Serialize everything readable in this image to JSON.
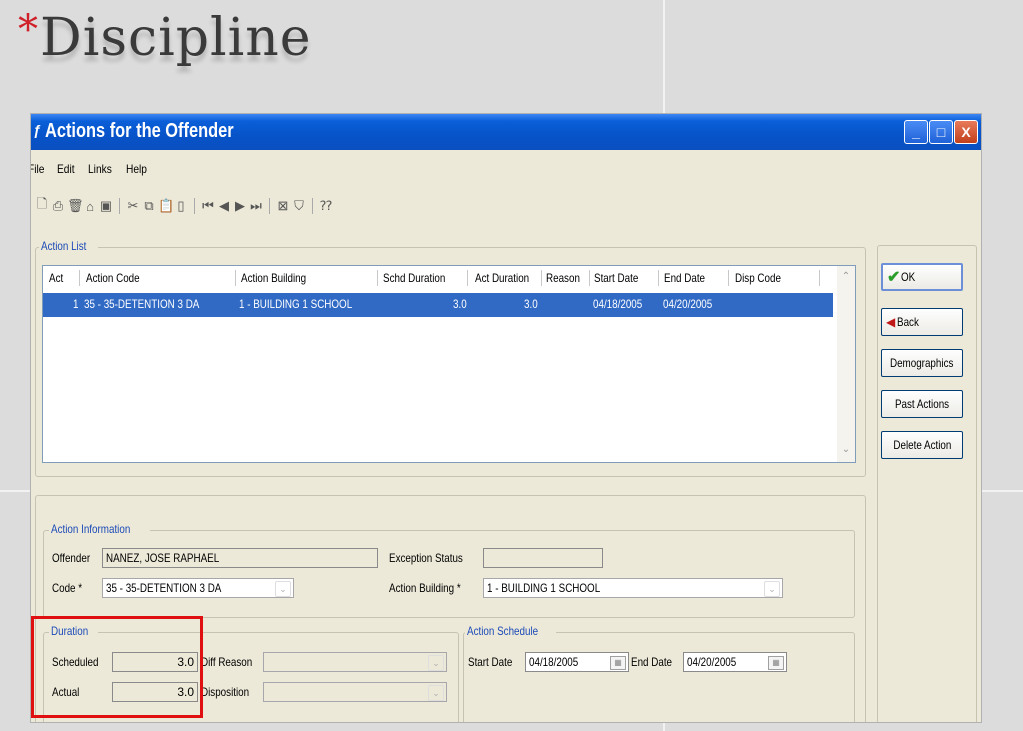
{
  "slide": {
    "star": "*",
    "title": "Discipline"
  },
  "window": {
    "title": "Actions for the Offender",
    "min_glyph": "_",
    "max_glyph": "□",
    "close_glyph": "X"
  },
  "menu": {
    "file": "File",
    "edit": "Edit",
    "links": "Links",
    "help": "Help"
  },
  "action_list": {
    "group_label": "Action List",
    "columns": [
      "Act",
      "Action Code",
      "Action Building",
      "Schd Duration",
      "Act Duration",
      "Reason",
      "Start Date",
      "End Date",
      "Disp Code"
    ],
    "rows": [
      {
        "act": "1",
        "action_code": "35 - 35-DETENTION 3 DA",
        "action_building": "1 - BUILDING 1 SCHOOL",
        "schd_duration": "3.0",
        "act_duration": "3.0",
        "reason": "",
        "start_date": "04/18/2005",
        "end_date": "04/20/2005",
        "disp_code": ""
      }
    ]
  },
  "buttons": {
    "ok": "OK",
    "back": "Back",
    "demographics": "Demographics",
    "past_actions": "Past Actions",
    "delete_action": "Delete Action"
  },
  "action_info": {
    "group_label": "Action Information",
    "offender_label": "Offender",
    "offender_value": "NANEZ, JOSE RAPHAEL",
    "exception_status_label": "Exception Status",
    "exception_status_value": "",
    "code_label": "Code *",
    "code_value": "35 - 35-DETENTION 3 DA",
    "action_building_label": "Action Building *",
    "action_building_value": "1 - BUILDING 1 SCHOOL"
  },
  "duration": {
    "group_label": "Duration",
    "scheduled_label": "Scheduled",
    "scheduled_value": "3.0",
    "actual_label": "Actual",
    "actual_value": "3.0",
    "diff_reason_label": "Diff Reason",
    "diff_reason_value": "",
    "disposition_label": "Disposition",
    "disposition_value": ""
  },
  "schedule": {
    "group_label": "Action Schedule",
    "start_date_label": "Start Date",
    "start_date_value": "04/18/2005",
    "end_date_label": "End Date",
    "end_date_value": "04/20/2005"
  },
  "colors": {
    "highlight": "#e01010",
    "selection": "#316ac5",
    "titlebar": "#0753c9"
  }
}
